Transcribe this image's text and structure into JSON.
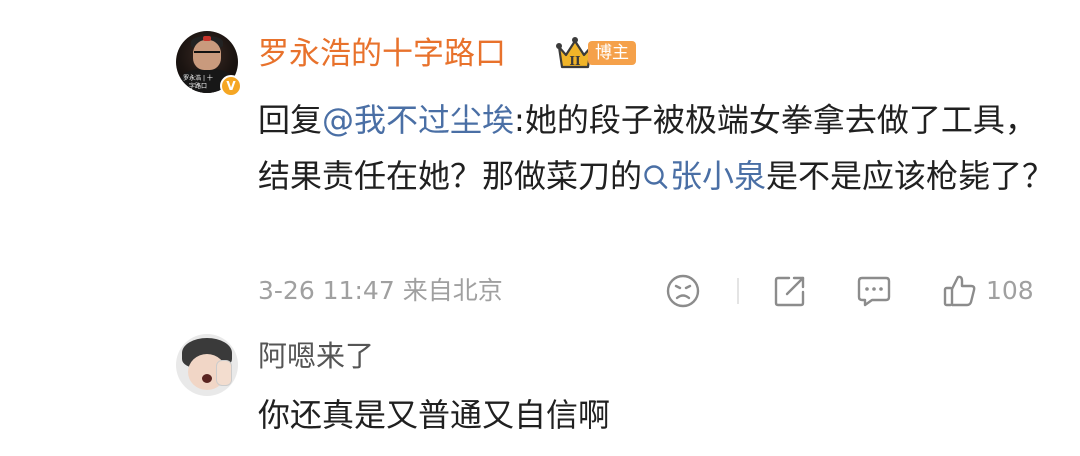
{
  "comment1": {
    "author": "罗永浩的十字路口",
    "avatar_text": "罗永浩 | 十字路口",
    "verified_badge": "V",
    "host_tag": "博主",
    "crown_level": "II",
    "reply_prefix": "回复",
    "mention": "@我不过尘埃",
    "text_part1": ":她的段子被极端女拳拿去做了工具，结果责任在她？那做菜刀的",
    "search_keyword": "张小泉",
    "text_part2": "是不是应该枪毙了？",
    "date": "3-26 11:47",
    "location": "来自北京",
    "like_count": "108"
  },
  "comment2": {
    "author": "阿嗯来了",
    "text": "你还真是又普通又自信啊"
  },
  "colors": {
    "author_highlight": "#e8722c",
    "link": "#4a6fa5",
    "meta": "#a0a0a0",
    "host_tag_bg": "#f5a14a",
    "crown": "#f0b429"
  },
  "icons": {
    "crown": "crown-icon",
    "search": "search-icon",
    "dislike": "sad-face-icon",
    "share": "share-icon",
    "comment": "comment-icon",
    "like": "thumbs-up-icon"
  }
}
